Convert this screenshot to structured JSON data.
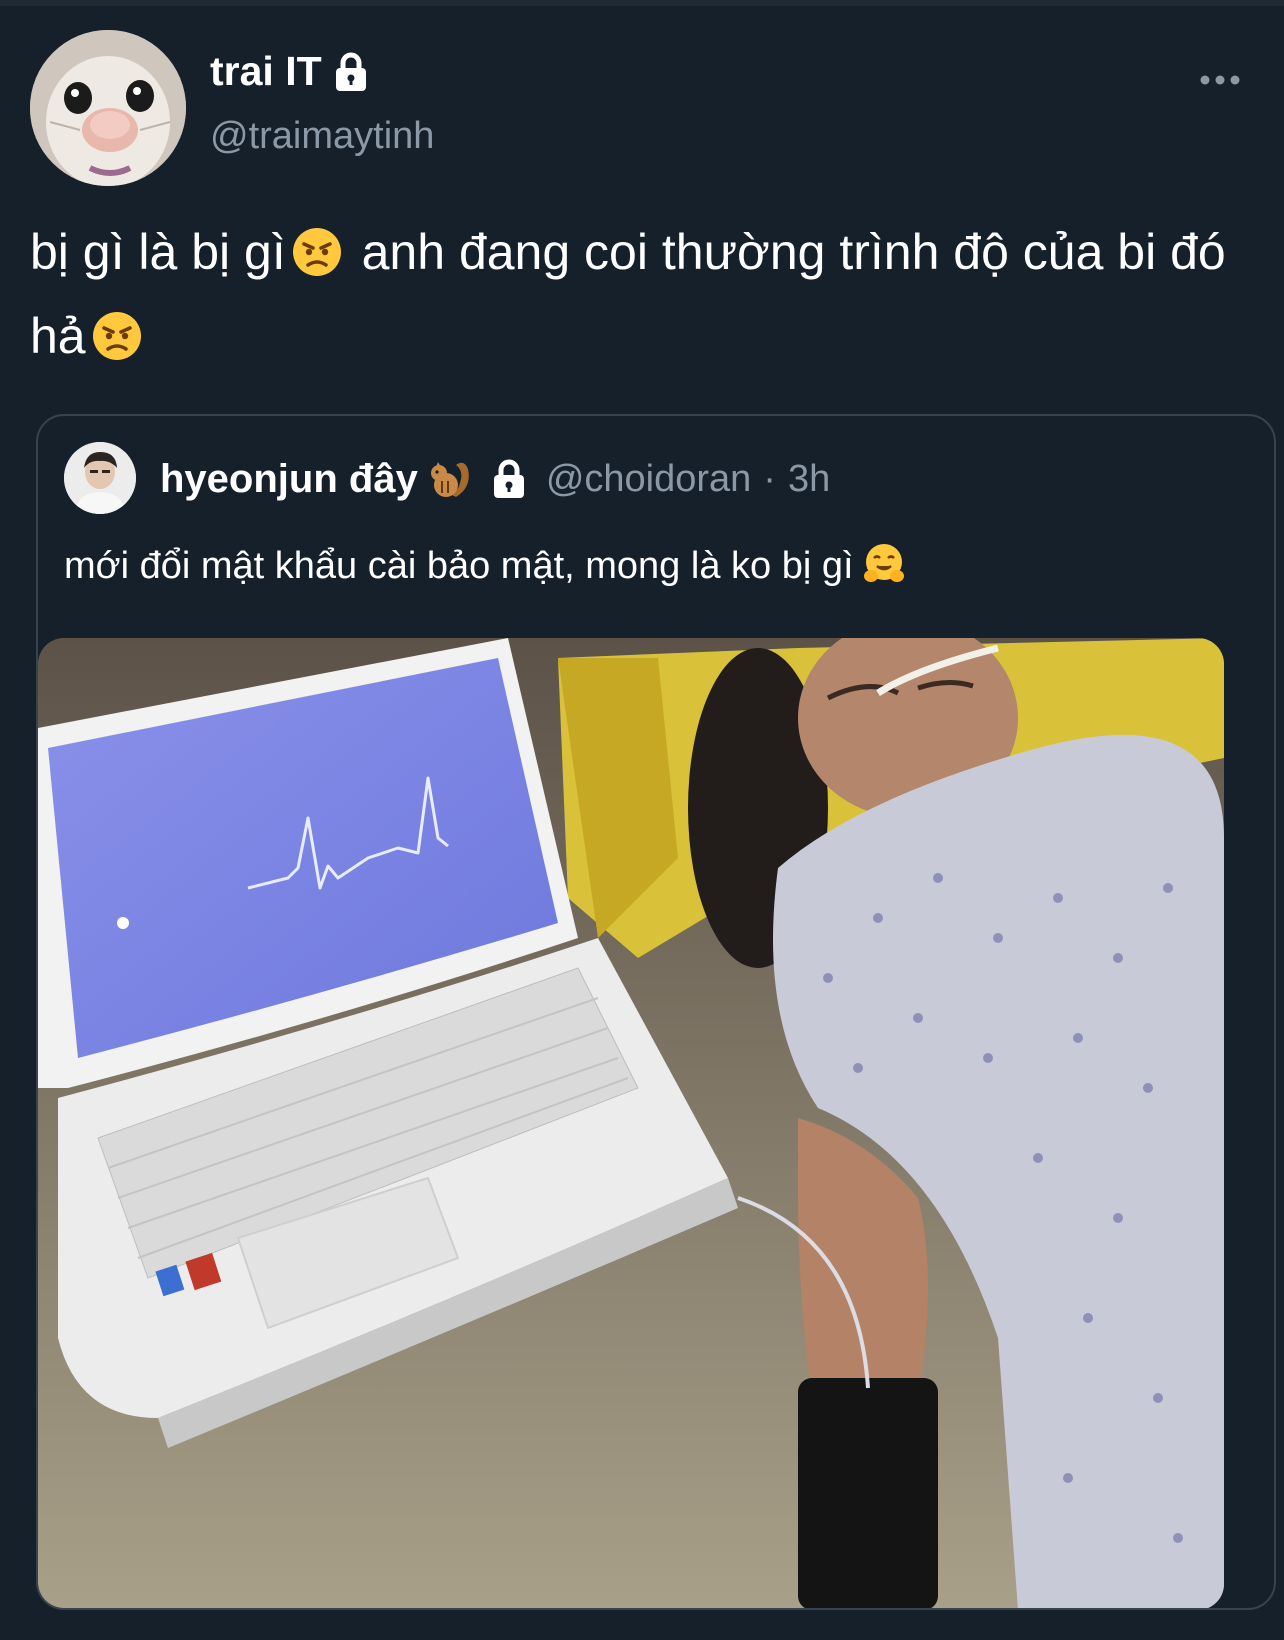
{
  "tweet": {
    "author": {
      "display_name": "trai IT",
      "handle": "@traimaytinh",
      "protected_icon": "lock-icon",
      "avatar_icon": "rat-avatar"
    },
    "text_part1": "bị gì là bị gì",
    "text_part2": "anh đang coi thường trình độ của bi đó hả",
    "emoji": "angry-face",
    "more_icon": "more-horizontal-icon"
  },
  "quote": {
    "author": {
      "display_name": "hyeonjun đây",
      "name_emoji": "chipmunk",
      "protected_icon": "lock-icon",
      "handle": "@choidoran",
      "separator": "·",
      "time": "3h"
    },
    "text": "mới đổi mật khẩu cài bảo mật, mong là ko bị gì",
    "text_emoji": "hugging-face",
    "media": {
      "type": "photo",
      "subject": "laptop-showing-heartbeat-next-to-person-in-bed"
    }
  },
  "colors": {
    "background": "#15202b",
    "border": "#38444d",
    "secondary_text": "#8b98a5",
    "primary_text": "#ffffff"
  }
}
